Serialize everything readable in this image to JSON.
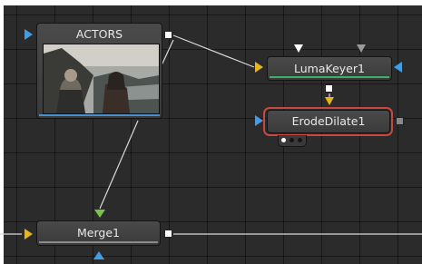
{
  "nodes": {
    "actors": {
      "title": "ACTORS"
    },
    "lumakeyer": {
      "title": "LumaKeyer1"
    },
    "erodedilate": {
      "title": "ErodeDilate1"
    },
    "merge": {
      "title": "Merge1"
    }
  },
  "colors": {
    "canvas": "#2b2b2b",
    "input_blue": "#3f9ee6",
    "input_yellow": "#e8b517",
    "input_green": "#7cc24a",
    "selected_outline": "#c8473f",
    "actors_bar": "#4a8fd0",
    "lumakeyer_bar": "#3fae6a",
    "merge_bar": "#8a8a8a"
  }
}
